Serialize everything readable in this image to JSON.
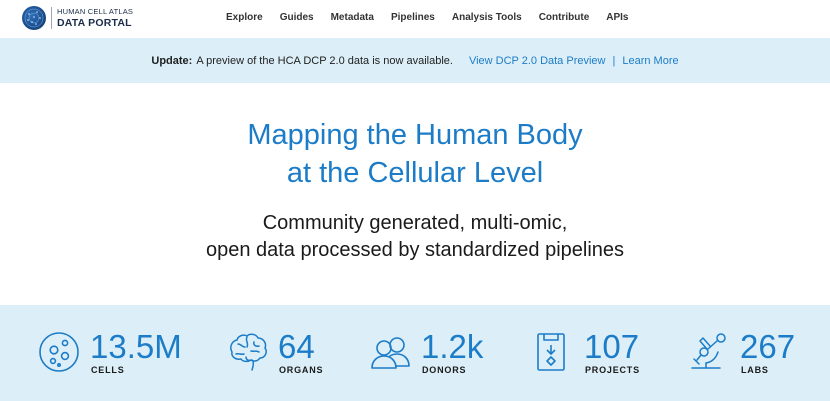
{
  "header": {
    "logo": {
      "line1": "HUMAN CELL ATLAS",
      "line2": "DATA PORTAL"
    },
    "nav": [
      {
        "label": "Explore"
      },
      {
        "label": "Guides"
      },
      {
        "label": "Metadata"
      },
      {
        "label": "Pipelines"
      },
      {
        "label": "Analysis Tools"
      },
      {
        "label": "Contribute"
      },
      {
        "label": "APIs"
      }
    ]
  },
  "banner": {
    "strong": "Update:",
    "text": "A preview of the HCA DCP 2.0 data is now available.",
    "link_preview": "View DCP 2.0 Data Preview",
    "separator": "|",
    "link_learn": "Learn More"
  },
  "hero": {
    "title_line1": "Mapping the Human Body",
    "title_line2": "at the Cellular Level",
    "subtitle_line1": "Community generated, multi-omic,",
    "subtitle_line2": "open data processed by standardized pipelines"
  },
  "stats": [
    {
      "value": "13.5M",
      "label": "CELLS",
      "icon": "cells-icon"
    },
    {
      "value": "64",
      "label": "ORGANS",
      "icon": "brain-icon"
    },
    {
      "value": "1.2k",
      "label": "DONORS",
      "icon": "donors-icon"
    },
    {
      "value": "107",
      "label": "PROJECTS",
      "icon": "projects-icon"
    },
    {
      "value": "267",
      "label": "LABS",
      "icon": "microscope-icon"
    }
  ],
  "colors": {
    "accent": "#1c7cc7",
    "banner_bg": "#dceff8",
    "logo_navy": "#1c2d4a"
  }
}
